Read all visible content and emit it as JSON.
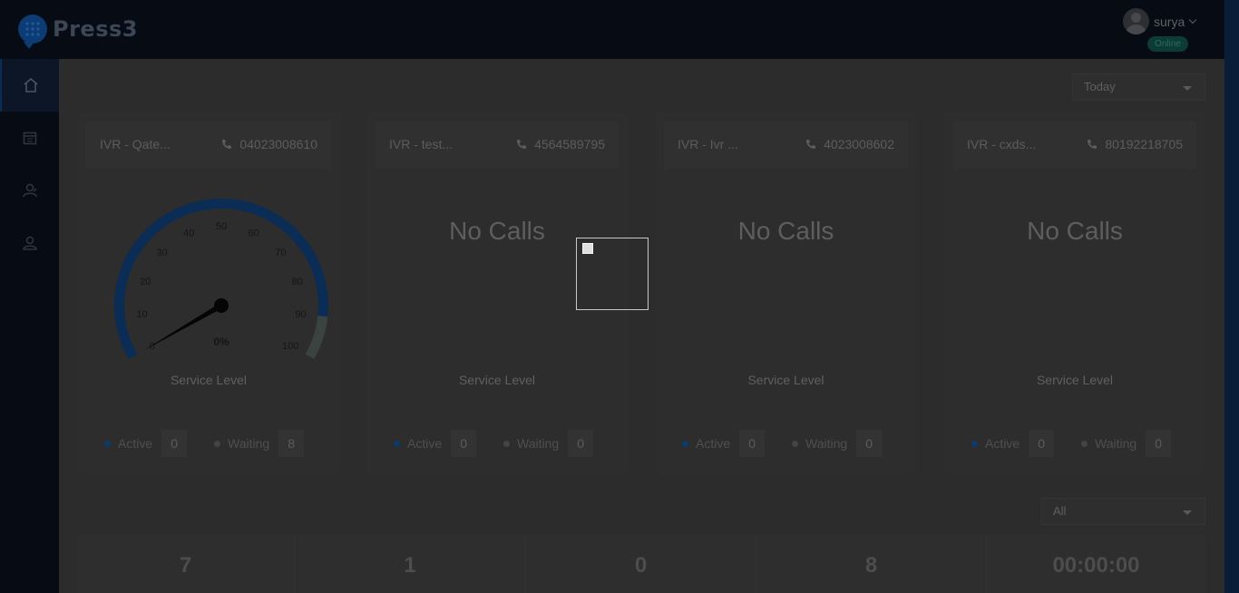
{
  "app": {
    "name": "Press3"
  },
  "user": {
    "name": "surya",
    "status": "Online"
  },
  "filters": {
    "period": "Today",
    "scope": "All"
  },
  "cards": [
    {
      "ivr": "IVR - Qate...",
      "phone": "04023008610",
      "gauge_value": "0%",
      "service_level_label": "Service Level",
      "active_label": "Active",
      "active": "0",
      "waiting_label": "Waiting",
      "waiting": "8"
    },
    {
      "ivr": "IVR - test...",
      "phone": "4564589795",
      "no_calls": "No Calls",
      "service_level_label": "Service Level",
      "active_label": "Active",
      "active": "0",
      "waiting_label": "Waiting",
      "waiting": "0"
    },
    {
      "ivr": "IVR - Ivr ...",
      "phone": "4023008602",
      "no_calls": "No Calls",
      "service_level_label": "Service Level",
      "active_label": "Active",
      "active": "0",
      "waiting_label": "Waiting",
      "waiting": "0"
    },
    {
      "ivr": "IVR - cxds...",
      "phone": "80192218705",
      "no_calls": "No Calls",
      "service_level_label": "Service Level",
      "active_label": "Active",
      "active": "0",
      "waiting_label": "Waiting",
      "waiting": "0"
    }
  ],
  "gauge_ticks": [
    "0",
    "10",
    "20",
    "30",
    "40",
    "50",
    "60",
    "70",
    "80",
    "90",
    "100"
  ],
  "summary": [
    {
      "value": "7",
      "label": ""
    },
    {
      "value": "1",
      "label": ""
    },
    {
      "value": "0",
      "label": ""
    },
    {
      "value": "8",
      "label": ""
    },
    {
      "value": "00:00:00",
      "label": ""
    }
  ],
  "colors": {
    "accent": "#0b2c55",
    "topbar": "#070b13",
    "online": "#0d3b35"
  }
}
